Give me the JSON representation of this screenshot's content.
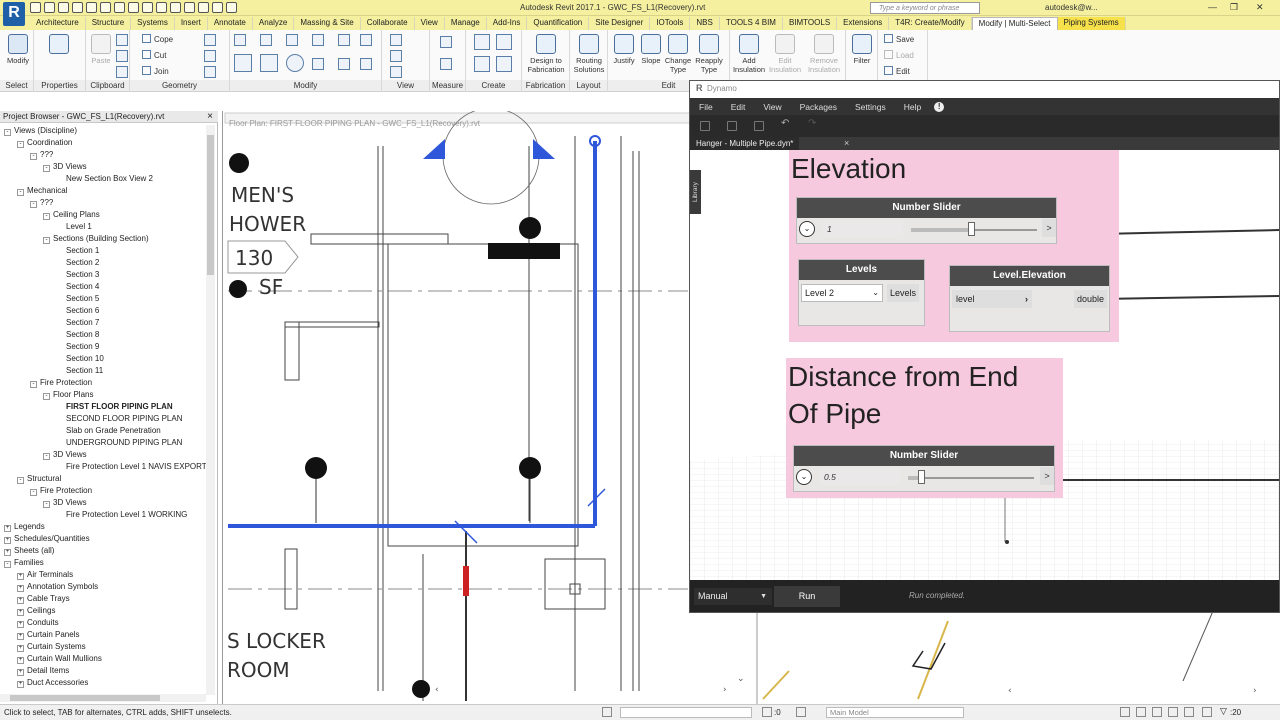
{
  "app": {
    "title": "Autodesk Revit 2017.1 -    GWC_FS_L1(Recovery).rvt",
    "search_placeholder": "Type a keyword or phrase",
    "user": "autodesk@w...",
    "logo": "R"
  },
  "ribbon_tabs": [
    "Architecture",
    "Structure",
    "Systems",
    "Insert",
    "Annotate",
    "Analyze",
    "Massing & Site",
    "Collaborate",
    "View",
    "Manage",
    "Add-Ins",
    "Quantification",
    "Site Designer",
    "IOTools",
    "NBS",
    "TOOLS 4 BIM",
    "BIMTOOLS",
    "Extensions",
    "T4R: Create/Modify",
    "Modify | Multi-Select",
    "Piping Systems"
  ],
  "ribbon": {
    "modify_label": "Modify",
    "paste_label": "Paste",
    "cope_label": "Cope",
    "cut_label": "Cut",
    "join_label": "Join",
    "panels": [
      "Select",
      "Properties",
      "Clipboard",
      "Geometry",
      "Modify",
      "View",
      "Measure",
      "Create",
      "Fabrication",
      "Layout",
      "Edit",
      "",
      ""
    ],
    "design_to_fab": "Design to Fabrication",
    "routing": "Routing Solutions",
    "justify": "Justify",
    "slope": "Slope",
    "change_type": "Change Type",
    "reapply_type": "Reapply Type",
    "add_insulation": "Add Insulation",
    "edit_insulation": "Edit Insulation",
    "remove_insulation": "Remove Insulation",
    "filter": "Filter",
    "save": "Save",
    "load": "Load",
    "edit": "Edit"
  },
  "project_browser": {
    "title": "Project Browser - GWC_FS_L1(Recovery).rvt",
    "tree": [
      {
        "label": "Views (Discipline)",
        "level": 0,
        "toggle": "-"
      },
      {
        "label": "Coordination",
        "level": 1,
        "toggle": "-"
      },
      {
        "label": "???",
        "level": 2,
        "toggle": "-"
      },
      {
        "label": "3D Views",
        "level": 3,
        "toggle": "-"
      },
      {
        "label": "New Section Box View 2",
        "level": 4,
        "toggle": ""
      },
      {
        "label": "Mechanical",
        "level": 1,
        "toggle": "-"
      },
      {
        "label": "???",
        "level": 2,
        "toggle": "-"
      },
      {
        "label": "Ceiling Plans",
        "level": 3,
        "toggle": "-"
      },
      {
        "label": "Level 1",
        "level": 4,
        "toggle": ""
      },
      {
        "label": "Sections (Building Section)",
        "level": 3,
        "toggle": "-"
      },
      {
        "label": "Section 1",
        "level": 4,
        "toggle": ""
      },
      {
        "label": "Section 2",
        "level": 4,
        "toggle": ""
      },
      {
        "label": "Section 3",
        "level": 4,
        "toggle": ""
      },
      {
        "label": "Section 4",
        "level": 4,
        "toggle": ""
      },
      {
        "label": "Section 5",
        "level": 4,
        "toggle": ""
      },
      {
        "label": "Section 6",
        "level": 4,
        "toggle": ""
      },
      {
        "label": "Section 7",
        "level": 4,
        "toggle": ""
      },
      {
        "label": "Section 8",
        "level": 4,
        "toggle": ""
      },
      {
        "label": "Section 9",
        "level": 4,
        "toggle": ""
      },
      {
        "label": "Section 10",
        "level": 4,
        "toggle": ""
      },
      {
        "label": "Section 11",
        "level": 4,
        "toggle": ""
      },
      {
        "label": "Fire Protection",
        "level": 2,
        "toggle": "-"
      },
      {
        "label": "Floor Plans",
        "level": 3,
        "toggle": "-"
      },
      {
        "label": "FIRST FLOOR PIPING PLAN",
        "level": 4,
        "toggle": "",
        "bold": true
      },
      {
        "label": "SECOND FLOOR PIPING PLAN",
        "level": 4,
        "toggle": ""
      },
      {
        "label": "Slab on Grade Penetration",
        "level": 4,
        "toggle": ""
      },
      {
        "label": "UNDERGROUND PIPING PLAN",
        "level": 4,
        "toggle": ""
      },
      {
        "label": "3D Views",
        "level": 3,
        "toggle": "-"
      },
      {
        "label": "Fire Protection Level 1 NAVIS EXPORT",
        "level": 4,
        "toggle": ""
      },
      {
        "label": "Structural",
        "level": 1,
        "toggle": "-"
      },
      {
        "label": "Fire Protection",
        "level": 2,
        "toggle": "-"
      },
      {
        "label": "3D Views",
        "level": 3,
        "toggle": "-"
      },
      {
        "label": "Fire Protection Level 1 WORKING",
        "level": 4,
        "toggle": ""
      },
      {
        "label": "Legends",
        "level": 0,
        "toggle": "+"
      },
      {
        "label": "Schedules/Quantities",
        "level": 0,
        "toggle": "+"
      },
      {
        "label": "Sheets (all)",
        "level": 0,
        "toggle": "+"
      },
      {
        "label": "Families",
        "level": 0,
        "toggle": "-"
      },
      {
        "label": "Air Terminals",
        "level": 1,
        "toggle": "+"
      },
      {
        "label": "Annotation Symbols",
        "level": 1,
        "toggle": "+"
      },
      {
        "label": "Cable Trays",
        "level": 1,
        "toggle": "+"
      },
      {
        "label": "Ceilings",
        "level": 1,
        "toggle": "+"
      },
      {
        "label": "Conduits",
        "level": 1,
        "toggle": "+"
      },
      {
        "label": "Curtain Panels",
        "level": 1,
        "toggle": "+"
      },
      {
        "label": "Curtain Systems",
        "level": 1,
        "toggle": "+"
      },
      {
        "label": "Curtain Wall Mullions",
        "level": 1,
        "toggle": "+"
      },
      {
        "label": "Detail Items",
        "level": 1,
        "toggle": "+"
      },
      {
        "label": "Duct Accessories",
        "level": 1,
        "toggle": "+"
      }
    ]
  },
  "view": {
    "tab_title": "Floor Plan: FIRST FLOOR PIPING PLAN - GWC_FS_L1(Recovery).rvt",
    "room_text_1": "MEN'S",
    "room_text_2": "HOWER",
    "room_number": "130",
    "room_area": "SF",
    "locker_1": "S LOCKER",
    "locker_2": "ROOM"
  },
  "dynamo": {
    "title": "Dynamo",
    "menu": [
      "File",
      "Edit",
      "View",
      "Packages",
      "Settings",
      "Help"
    ],
    "file_tab": "Hanger - Multiple Pipe.dyn*",
    "library_label": "Library",
    "group1_title": "Elevation",
    "group2_title_1": "Distance from End",
    "group2_title_2": "Of Pipe",
    "slider1": {
      "title": "Number Slider",
      "value": "1",
      "level": 0.48
    },
    "slider2": {
      "title": "Number Slider",
      "value": "0.5",
      "level": 0.1
    },
    "levels_node": {
      "title": "Levels",
      "selected": "Level 2",
      "output": "Levels"
    },
    "level_elev_node": {
      "title": "Level.Elevation",
      "input": "level",
      "output": "double"
    },
    "run_mode": "Manual",
    "run_label": "Run",
    "run_status": "Run completed."
  },
  "status_bar": {
    "hint": "Click to select, TAB for alternates, CTRL adds, SHIFT unselects.",
    "zero": ":0",
    "model": "Main Model",
    "filter_count": ":20"
  },
  "colors": {
    "title_bar": "#f4f0a0",
    "pipe_blue": "#2f57d9",
    "dynamo_group": "#f7c9df"
  }
}
